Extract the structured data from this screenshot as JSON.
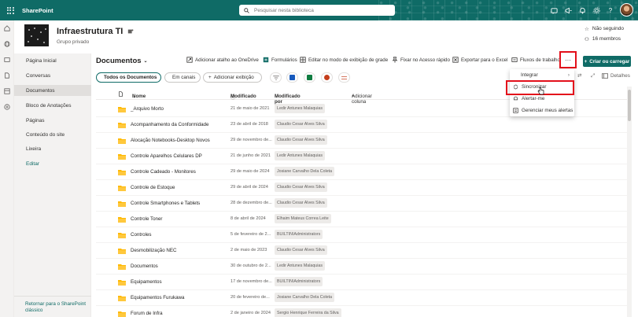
{
  "app": {
    "name": "SharePoint"
  },
  "search": {
    "placeholder": "Pesquisar nesta biblioteca"
  },
  "site": {
    "title": "Infraestrutura TI",
    "subtitle": "Grupo privado",
    "follow": "Não seguindo",
    "members": "16 membros"
  },
  "nav": {
    "items": [
      "Página Inicial",
      "Conversas",
      "Documentos",
      "Bloco de Anotações",
      "Páginas",
      "Conteúdo do site",
      "Lixeira",
      "Editar"
    ],
    "selected": "Documentos",
    "classic_link": "Retornar para o SharePoint clássico"
  },
  "library": {
    "title": "Documentos"
  },
  "commands": {
    "shortcut": "Adicionar atalho ao OneDrive",
    "forms": "Formulários",
    "grid": "Editar no modo de exibição de grade",
    "pin": "Fixar no Acesso rápido",
    "excel": "Exportar para o Excel",
    "flows": "Fluxos de trabalho",
    "more": "···",
    "new": "Criar ou carregar"
  },
  "views": {
    "all": "Todos os Documentos",
    "channels": "Em canais",
    "add": "Adicionar exibição",
    "details": "Detalhes"
  },
  "menu": {
    "items": [
      "Integrar",
      "Sincronizar",
      "Alertar-me",
      "Gerenciar meus alertas"
    ]
  },
  "table": {
    "headers": {
      "name": "Nome",
      "modified": "Modificado",
      "modified_by": "Modificado por",
      "add_column": "Adicionar coluna"
    },
    "rows": [
      {
        "name": "_Arquivo Morto",
        "modified": "21 de maio de 2021",
        "by": "Ledir Antunes Malaquias"
      },
      {
        "name": "Acompanhamento da Conformidade",
        "modified": "23 de abril de 2018",
        "by": "Claudio Cesar Alves Silva"
      },
      {
        "name": "Alocação Notebooks-Desktop Novos",
        "modified": "29 de novembro de...",
        "by": "Claudio Cesar Alves Silva"
      },
      {
        "name": "Controle Aparelhos Celulares DP",
        "modified": "21 de junho de 2021",
        "by": "Ledir Antunes Malaquias"
      },
      {
        "name": "Controle Cadeado - Monitores",
        "modified": "29 de maio de 2024",
        "by": "Josiane Carvalho Dela Coleta"
      },
      {
        "name": "Controle de Estoque",
        "modified": "29 de abril de 2024",
        "by": "Claudio Cesar Alves Silva"
      },
      {
        "name": "Controle Smartphones e Tablets",
        "modified": "28 de dezembro de...",
        "by": "Claudio Cesar Alves Silva"
      },
      {
        "name": "Controle Toner",
        "modified": "8 de abril de 2024",
        "by": "Elhaim Mateus Correa Leite"
      },
      {
        "name": "Controles",
        "modified": "5 de fevereiro de 2...",
        "by": "BUILTIN\\Administrators"
      },
      {
        "name": "Desmobilização NEC",
        "modified": "2 de maio de 2023",
        "by": "Claudio Cesar Alves Silva"
      },
      {
        "name": "Documentos",
        "modified": "30 de outubro de 2...",
        "by": "Ledir Antunes Malaquias"
      },
      {
        "name": "Equipamentos",
        "modified": "17 de novembro de...",
        "by": "BUILTIN\\Administrators"
      },
      {
        "name": "Equipamentos Furukawa",
        "modified": "20 de fevereiro de...",
        "by": "Josiane Carvalho Dela Coleta"
      },
      {
        "name": "Forum de Infra",
        "modified": "2 de janeiro de 2024",
        "by": "Sergio Henrique Ferreira da Silva"
      }
    ]
  },
  "colors": {
    "accent": "#0f6b66",
    "highlight": "#e3101b",
    "folder": "#ffb900"
  }
}
